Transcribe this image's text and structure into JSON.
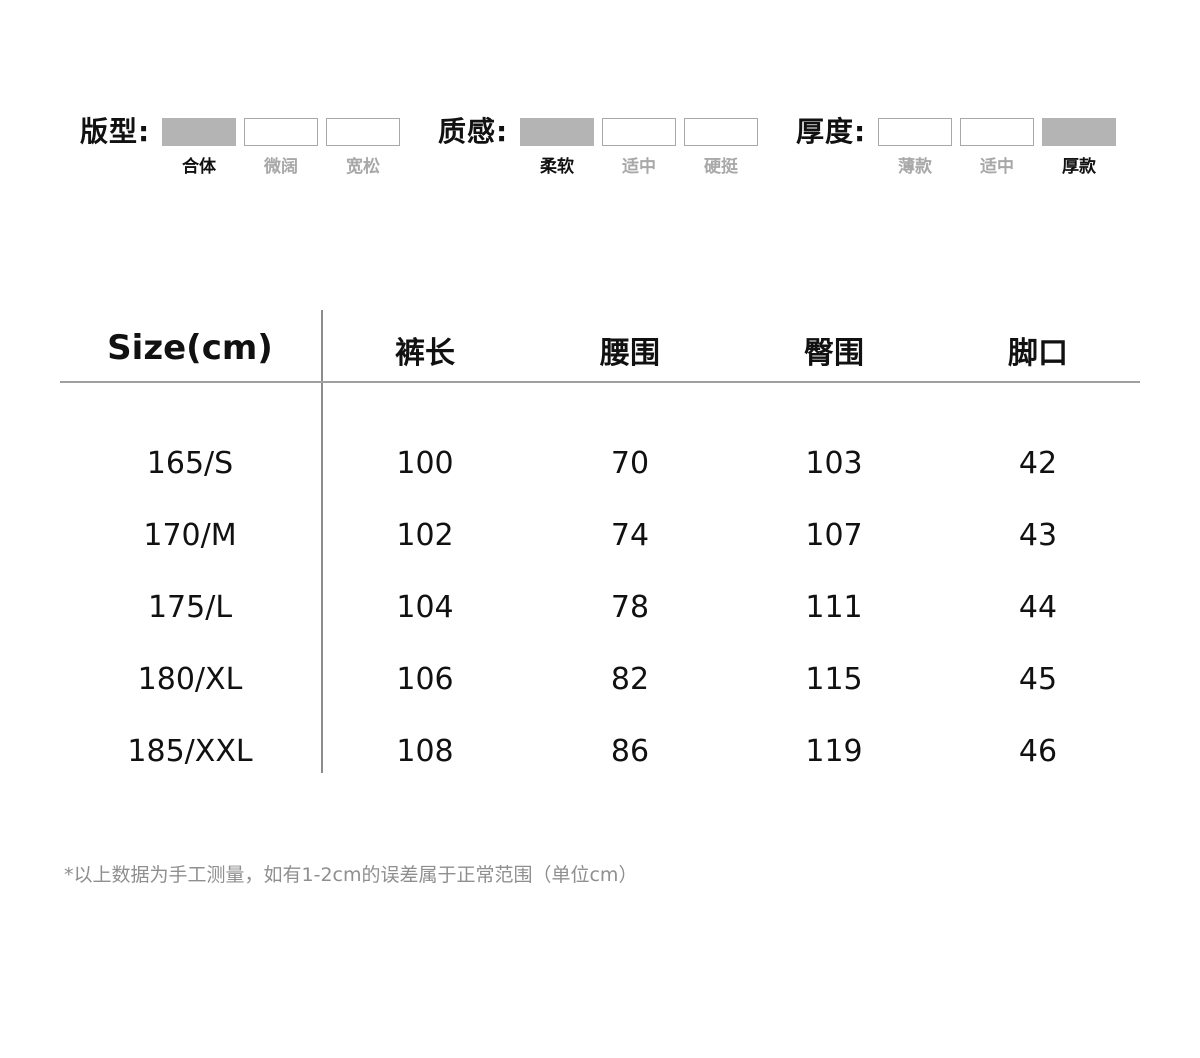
{
  "attributes": [
    {
      "title": "版型:",
      "options": [
        {
          "label": "合体",
          "selected": true
        },
        {
          "label": "微阔",
          "selected": false
        },
        {
          "label": "宽松",
          "selected": false
        }
      ]
    },
    {
      "title": "质感:",
      "options": [
        {
          "label": "柔软",
          "selected": true
        },
        {
          "label": "适中",
          "selected": false
        },
        {
          "label": "硬挺",
          "selected": false
        }
      ]
    },
    {
      "title": "厚度:",
      "options": [
        {
          "label": "薄款",
          "selected": false
        },
        {
          "label": "适中",
          "selected": false
        },
        {
          "label": "厚款",
          "selected": true
        }
      ]
    }
  ],
  "colors": {
    "selected_fill": "#b4b4b4",
    "unselected_label": "#a8a8a8",
    "text": "#111111",
    "note": "#8f8f8f"
  },
  "table": {
    "headers": [
      "Size(cm)",
      "裤长",
      "腰围",
      "臀围",
      "脚口"
    ],
    "rows": [
      [
        "165/S",
        "100",
        "70",
        "103",
        "42"
      ],
      [
        "170/M",
        "102",
        "74",
        "107",
        "43"
      ],
      [
        "175/L",
        "104",
        "78",
        "111",
        "44"
      ],
      [
        "180/XL",
        "106",
        "82",
        "115",
        "45"
      ],
      [
        "185/XXL",
        "108",
        "86",
        "119",
        "46"
      ]
    ]
  },
  "note": "*以上数据为手工测量，如有1-2cm的误差属于正常范围（单位cm）"
}
